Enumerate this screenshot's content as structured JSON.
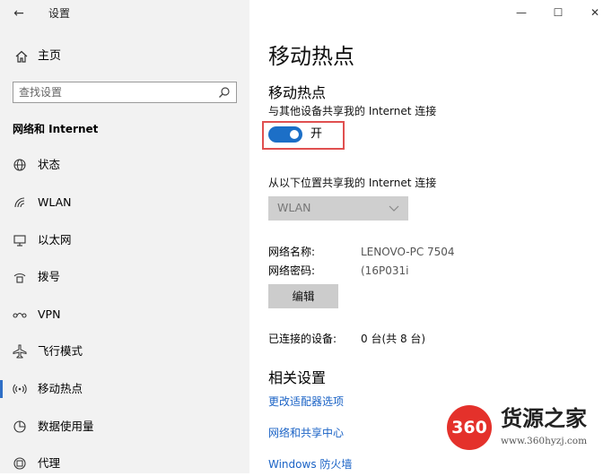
{
  "window": {
    "back_icon": "back-arrow-icon",
    "title": "设置",
    "controls": {
      "minimize": "—",
      "maximize": "☐",
      "close": "✕"
    }
  },
  "sidebar": {
    "home": {
      "label": "主页",
      "icon": "home-icon"
    },
    "search": {
      "placeholder": "查找设置",
      "icon": "search-icon"
    },
    "section_header": "网络和 Internet",
    "items": [
      {
        "label": "状态",
        "icon": "globe-icon",
        "active": false
      },
      {
        "label": "WLAN",
        "icon": "wifi-icon",
        "active": false
      },
      {
        "label": "以太网",
        "icon": "ethernet-icon",
        "active": false
      },
      {
        "label": "拨号",
        "icon": "dialup-icon",
        "active": false
      },
      {
        "label": "VPN",
        "icon": "vpn-icon",
        "active": false
      },
      {
        "label": "飞行模式",
        "icon": "airplane-icon",
        "active": false
      },
      {
        "label": "移动热点",
        "icon": "hotspot-icon",
        "active": true
      },
      {
        "label": "数据使用量",
        "icon": "data-usage-icon",
        "active": false
      },
      {
        "label": "代理",
        "icon": "proxy-icon",
        "active": false
      }
    ]
  },
  "main": {
    "page_title": "移动热点",
    "hotspot": {
      "title": "移动热点",
      "description": "与其他设备共享我的 Internet 连接",
      "toggle_state": "on",
      "toggle_label": "开"
    },
    "share_from": {
      "label": "从以下位置共享我的 Internet 连接",
      "selected": "WLAN"
    },
    "network_name_label": "网络名称:",
    "network_name_value": "LENOVO-PC 7504",
    "network_password_label": "网络密码:",
    "network_password_value": "(16P031i",
    "edit_button": "编辑",
    "connected_devices_label": "已连接的设备:",
    "connected_devices_value": "0 台(共 8 台)",
    "related": {
      "title": "相关设置",
      "links": [
        "更改适配器选项",
        "网络和共享中心",
        "Windows 防火墙"
      ]
    }
  },
  "watermark": {
    "badge": "360",
    "name": "货源之家",
    "url": "www.360hyzj.com"
  },
  "colors": {
    "accent": "#1c6fc7",
    "link": "#1b63c6",
    "highlight_border": "#e05050",
    "sidebar_bg": "#f2f2f2"
  }
}
